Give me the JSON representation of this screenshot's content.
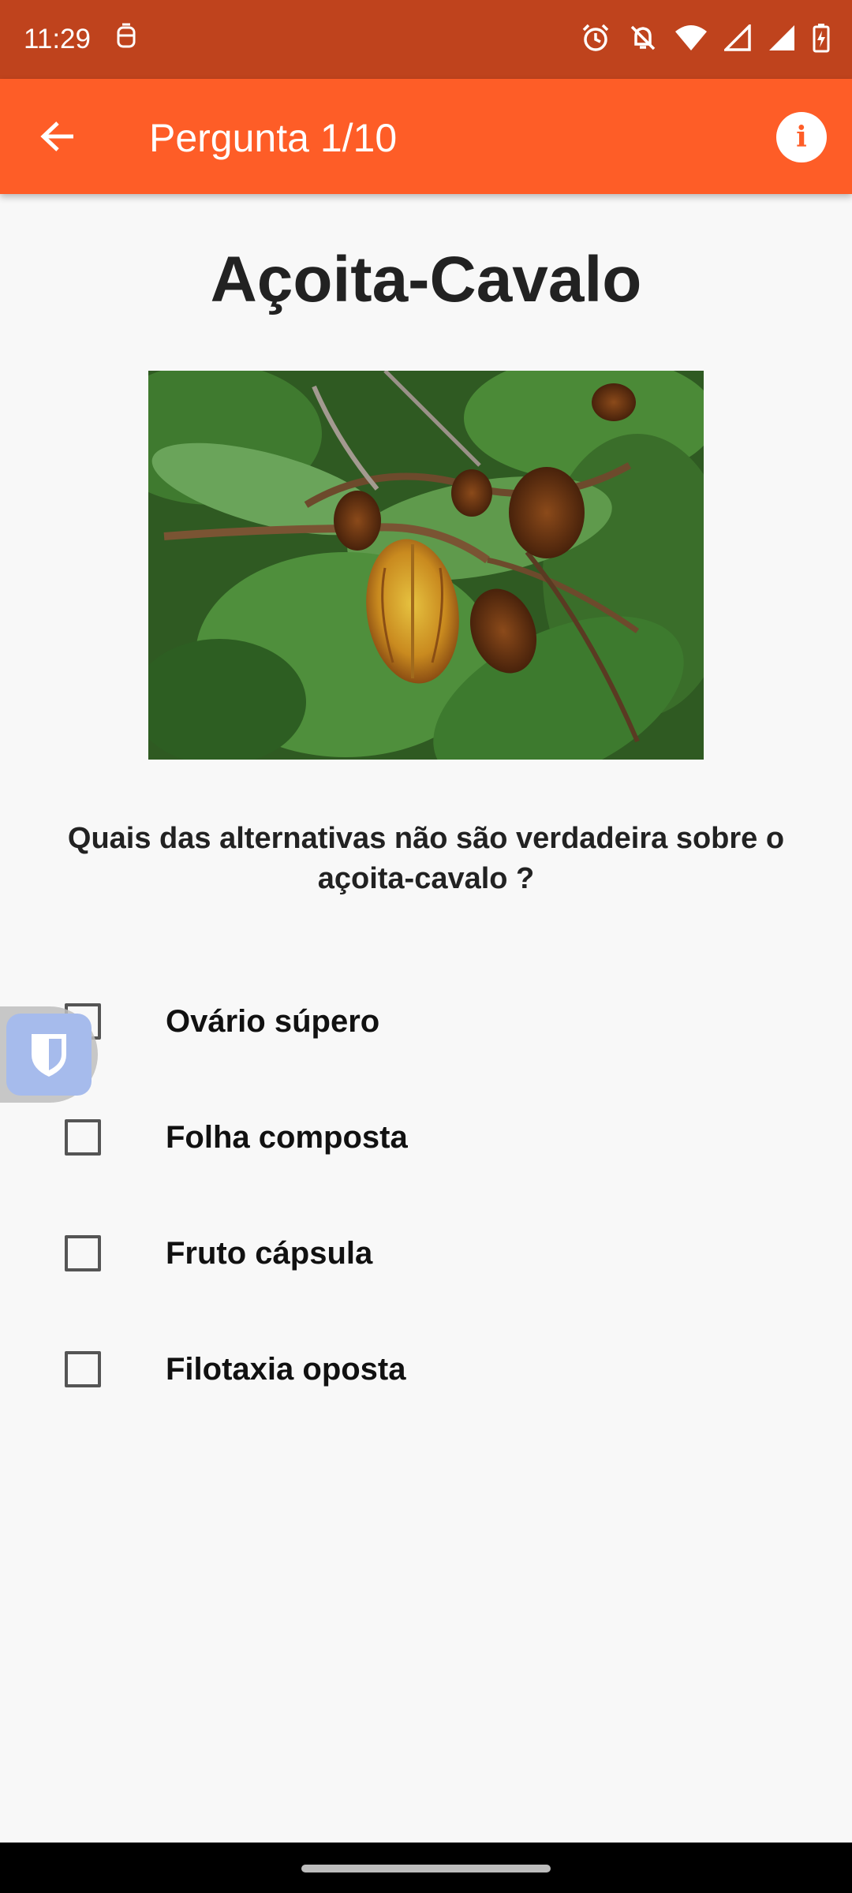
{
  "status_bar": {
    "time": "11:29",
    "icons": [
      "notification-icon",
      "alarm-icon",
      "bell-off-icon",
      "wifi-icon",
      "signal-icon",
      "signal-full-icon",
      "battery-charging-icon"
    ]
  },
  "app_bar": {
    "back_icon": "arrow-left-icon",
    "title": "Pergunta 1/10",
    "info_icon": "info-icon",
    "info_glyph": "i"
  },
  "quiz": {
    "plant_name": "Açoita-Cavalo",
    "question": "Quais das alternativas não são verdadeira sobre o açoita-cavalo ?",
    "options": [
      {
        "label": "Ovário súpero",
        "checked": false
      },
      {
        "label": "Folha composta",
        "checked": false
      },
      {
        "label": "Fruto cápsula",
        "checked": false
      },
      {
        "label": "Filotaxia oposta",
        "checked": false
      }
    ]
  },
  "colors": {
    "status_bar": "#bf431d",
    "app_bar": "#fe5d27",
    "background": "#f8f8f8"
  }
}
